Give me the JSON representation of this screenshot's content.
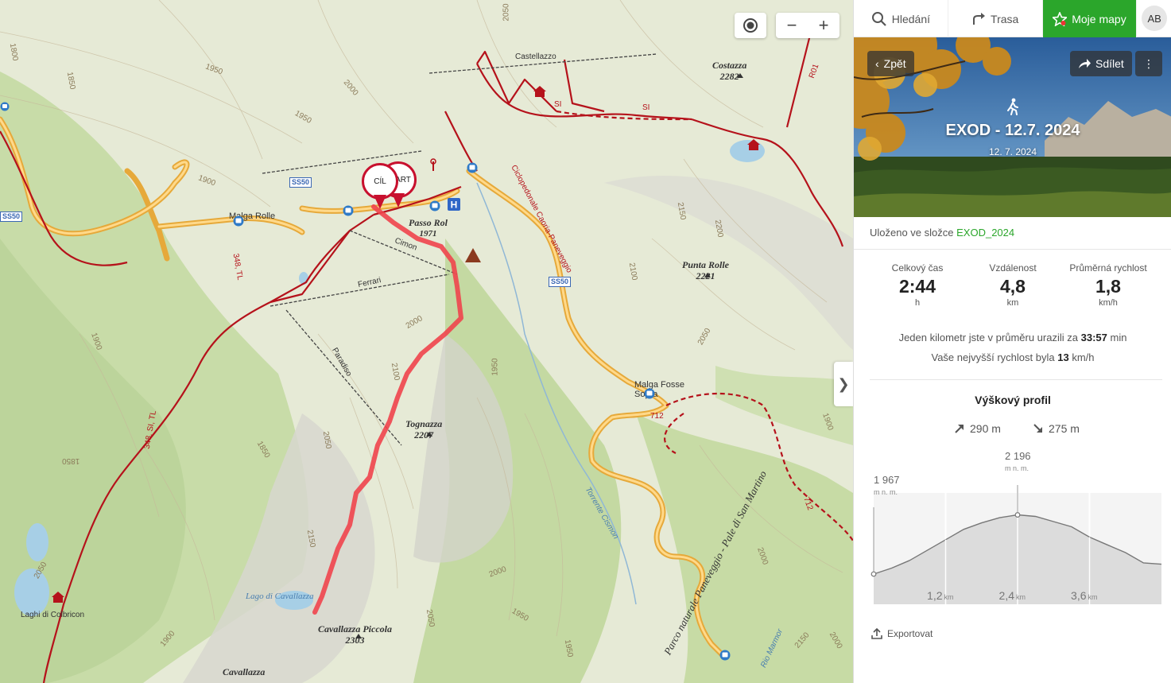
{
  "map": {
    "labels": {
      "costazza": {
        "name": "Costazza",
        "elev": "2282"
      },
      "punta_rolle": {
        "name": "Punta Rolle",
        "elev": "2221"
      },
      "tognazza": {
        "name": "Tognazza",
        "elev": "2207"
      },
      "cavallazza_piccola": {
        "name": "Cavallazza Piccola",
        "elev": "2303"
      },
      "cavallazza": "Cavallazza",
      "passo_rolle": {
        "name": "Passo Rol",
        "elev": "1971"
      },
      "castellazzo": "Castellazzo",
      "malga_rolle": "Malga Rolle",
      "malga_fosse": "Malga Fosse Sopra",
      "lago_cavallazza": "Lago di Cavallazza",
      "laghi_colbricon": "Laghi di Colbricon",
      "cimon": "Cimon",
      "ferrari": "Ferrari",
      "paradiso": "Paradiso",
      "ciclopedonale": "Ciclopedonale Caoria-Paneveggio",
      "parco": "Parco naturale Paneveggio - Pale di San Martino",
      "torrente": "Torrente Cismon",
      "rio_marmor": "Rio Marmor",
      "ss50_a": "SS50",
      "ss50_b": "SS50",
      "ss50_c": "SS50",
      "r348": "348, TL",
      "r348b": "348, SI, TL",
      "r712": "712",
      "r712b": "712",
      "r01": "R01",
      "si1": "SI",
      "si2": "SI",
      "contour": [
        "2050",
        "1950",
        "2000",
        "1950",
        "1900",
        "1850",
        "1800",
        "2150",
        "2200",
        "2100",
        "2050",
        "2000",
        "1950",
        "1900",
        "1850",
        "2100",
        "2050",
        "2150",
        "2050",
        "2000",
        "1950",
        "1850",
        "1900",
        "2150",
        "2050",
        "2000",
        "1950",
        "1900",
        "2000"
      ]
    },
    "pins": {
      "start": "START",
      "finish": "CÍL"
    },
    "controls": {
      "zoom_out": "−",
      "zoom_in": "+",
      "collapse": "❯"
    }
  },
  "panel": {
    "nav": {
      "search": "Hledání",
      "route": "Trasa",
      "mymaps": "Moje mapy",
      "avatar": "AB"
    },
    "hero": {
      "back": "Zpět",
      "share": "Sdílet",
      "more": "⋮",
      "title": "EXOD - 12.7. 2024",
      "date": "12. 7. 2024"
    },
    "folder": {
      "prefix": "Uloženo ve složce",
      "name": "EXOD_2024"
    },
    "stats": [
      {
        "label": "Celkový čas",
        "value": "2:44",
        "unit": "h"
      },
      {
        "label": "Vzdálenost",
        "value": "4,8",
        "unit": "km"
      },
      {
        "label": "Průměrná rychlost",
        "value": "1,8",
        "unit": "km/h"
      }
    ],
    "pace": {
      "prefix": "Jeden kilometr jste v průměru urazili za",
      "value": "33:57",
      "suffix": "min"
    },
    "maxspeed": {
      "prefix": "Vaše nejvyšší rychlost byla",
      "value": "13",
      "suffix": "km/h"
    },
    "profile": {
      "title": "Výškový profil",
      "ascent": "290 m",
      "descent": "275 m",
      "start_elev": "1 967",
      "max_elev": "2 196",
      "elev_unit": "m n. m.",
      "x_ticks": [
        {
          "value": "1,2",
          "unit": "km"
        },
        {
          "value": "2,4",
          "unit": "km"
        },
        {
          "value": "3,6",
          "unit": "km"
        }
      ]
    },
    "export": "Exportovat"
  },
  "chart_data": {
    "type": "area",
    "title": "Výškový profil",
    "x_unit": "km",
    "y_unit": "m n. m.",
    "x": [
      0,
      0.3,
      0.6,
      0.9,
      1.2,
      1.5,
      1.8,
      2.1,
      2.4,
      2.7,
      3.0,
      3.3,
      3.6,
      3.9,
      4.2,
      4.5,
      4.8
    ],
    "y": [
      1967,
      1990,
      2020,
      2060,
      2100,
      2140,
      2165,
      2185,
      2196,
      2190,
      2170,
      2150,
      2110,
      2080,
      2050,
      2010,
      2005
    ],
    "xticks": [
      1.2,
      2.4,
      3.6
    ],
    "annotations": [
      {
        "x": 0,
        "y": 1967,
        "label": "1 967"
      },
      {
        "x": 2.4,
        "y": 2196,
        "label": "2 196"
      }
    ],
    "grid": true
  }
}
